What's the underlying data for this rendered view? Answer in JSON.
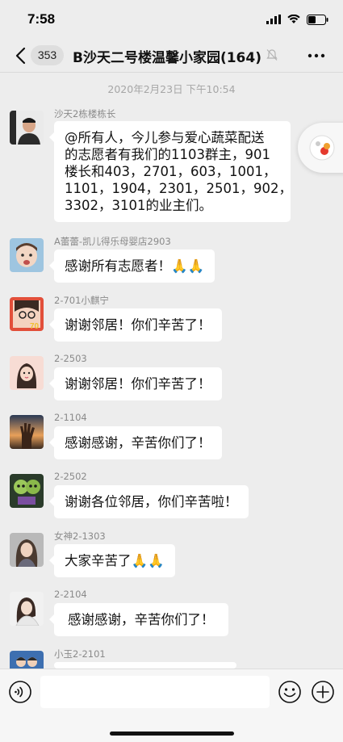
{
  "status_bar": {
    "time": "7:58",
    "battery_level": 0.45
  },
  "header": {
    "unread_count": "353",
    "title": "B沙天二号楼温馨小家园(164)",
    "muted": true
  },
  "timestamp": "2020年2月23日 下午10:54",
  "messages": [
    {
      "sender": "沙天2栋楼栋长",
      "lines": [
        "@所有人，今儿参与爱心蔬菜配送",
        "的志愿者有我们的1103群主，901",
        "楼长和403，2701，603，1001，",
        "1101，1904，2301，2501，902，",
        "3302，3101的业主们。"
      ],
      "avatar": "avatar-man-icon"
    },
    {
      "sender": "A蕾蕾-凯儿得乐母婴店2903",
      "text": "感谢所有志愿者！🙏🙏",
      "avatar": "avatar-baby-icon"
    },
    {
      "sender": "2-701小麒宁",
      "text": "谢谢邻居！你们辛苦了！",
      "avatar": "avatar-girl-glasses-icon"
    },
    {
      "sender": "2-2503",
      "text": "谢谢邻居！你们辛苦了！",
      "avatar": "avatar-cartoon-girl-icon"
    },
    {
      "sender": "2-1104",
      "text": "感谢感谢，辛苦你们了！",
      "avatar": "avatar-hand-sunset-icon"
    },
    {
      "sender": "2-2502",
      "text": "谢谢各位邻居，你们辛苦啦！",
      "avatar": "avatar-plants-icon"
    },
    {
      "sender": "女神2-1303",
      "text": "大家辛苦了🙏🙏",
      "avatar": "avatar-woman-icon"
    },
    {
      "sender": "2-2104",
      "text": "感谢感谢，辛苦你们了！",
      "avatar": "avatar-woman-white-icon"
    },
    {
      "sender": "小玉2-2101",
      "text": "",
      "avatar": "avatar-couple-icon"
    }
  ],
  "input": {
    "placeholder": ""
  },
  "colors": {
    "background": "#ededed",
    "bubble": "#ffffff",
    "timestamp": "#a6a6a6"
  }
}
